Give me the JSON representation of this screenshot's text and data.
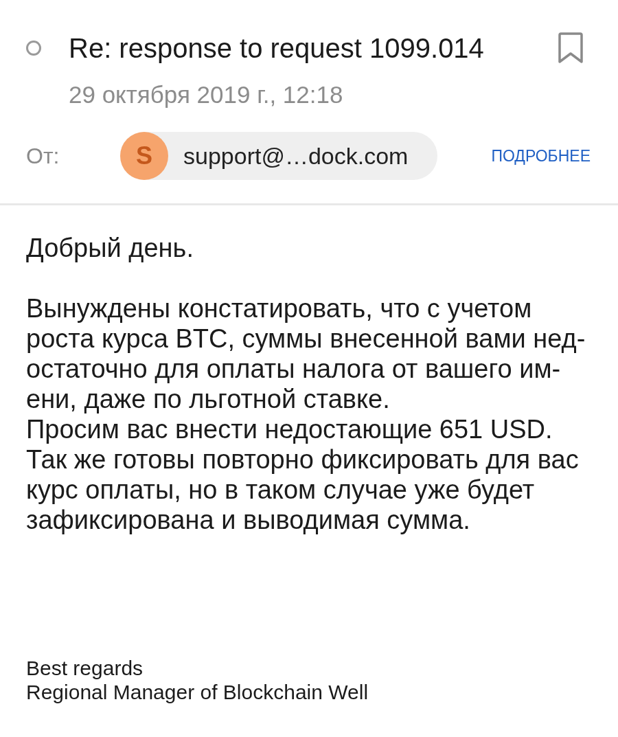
{
  "message": {
    "unread": false,
    "subject": "Re: response to request 1099.014",
    "flagged": false,
    "date": "29 октября 2019 г., 12:18"
  },
  "sender": {
    "label": "От:",
    "avatar_letter": "S",
    "address": "support@…dock.com",
    "details_link": "ПОДРОБНЕЕ"
  },
  "body": {
    "greeting": "Добрый день.",
    "paragraphs": [
      "Вынуждены констатировать, что с учетом\nроста курса BTC, суммы внесенной вами нед-\nостаточно для оплаты налога от вашего им-\nени, даже по льготной ставке.",
      "Просим вас внести недостающие 651 USD.",
      "Так же готовы повторно фиксировать для вас\nкурс оплаты, но в таком случае уже будет\nзафиксирована и выводимая сумма."
    ]
  },
  "signature": [
    "Best regards",
    "Regional Manager of Blockchain Well"
  ]
}
